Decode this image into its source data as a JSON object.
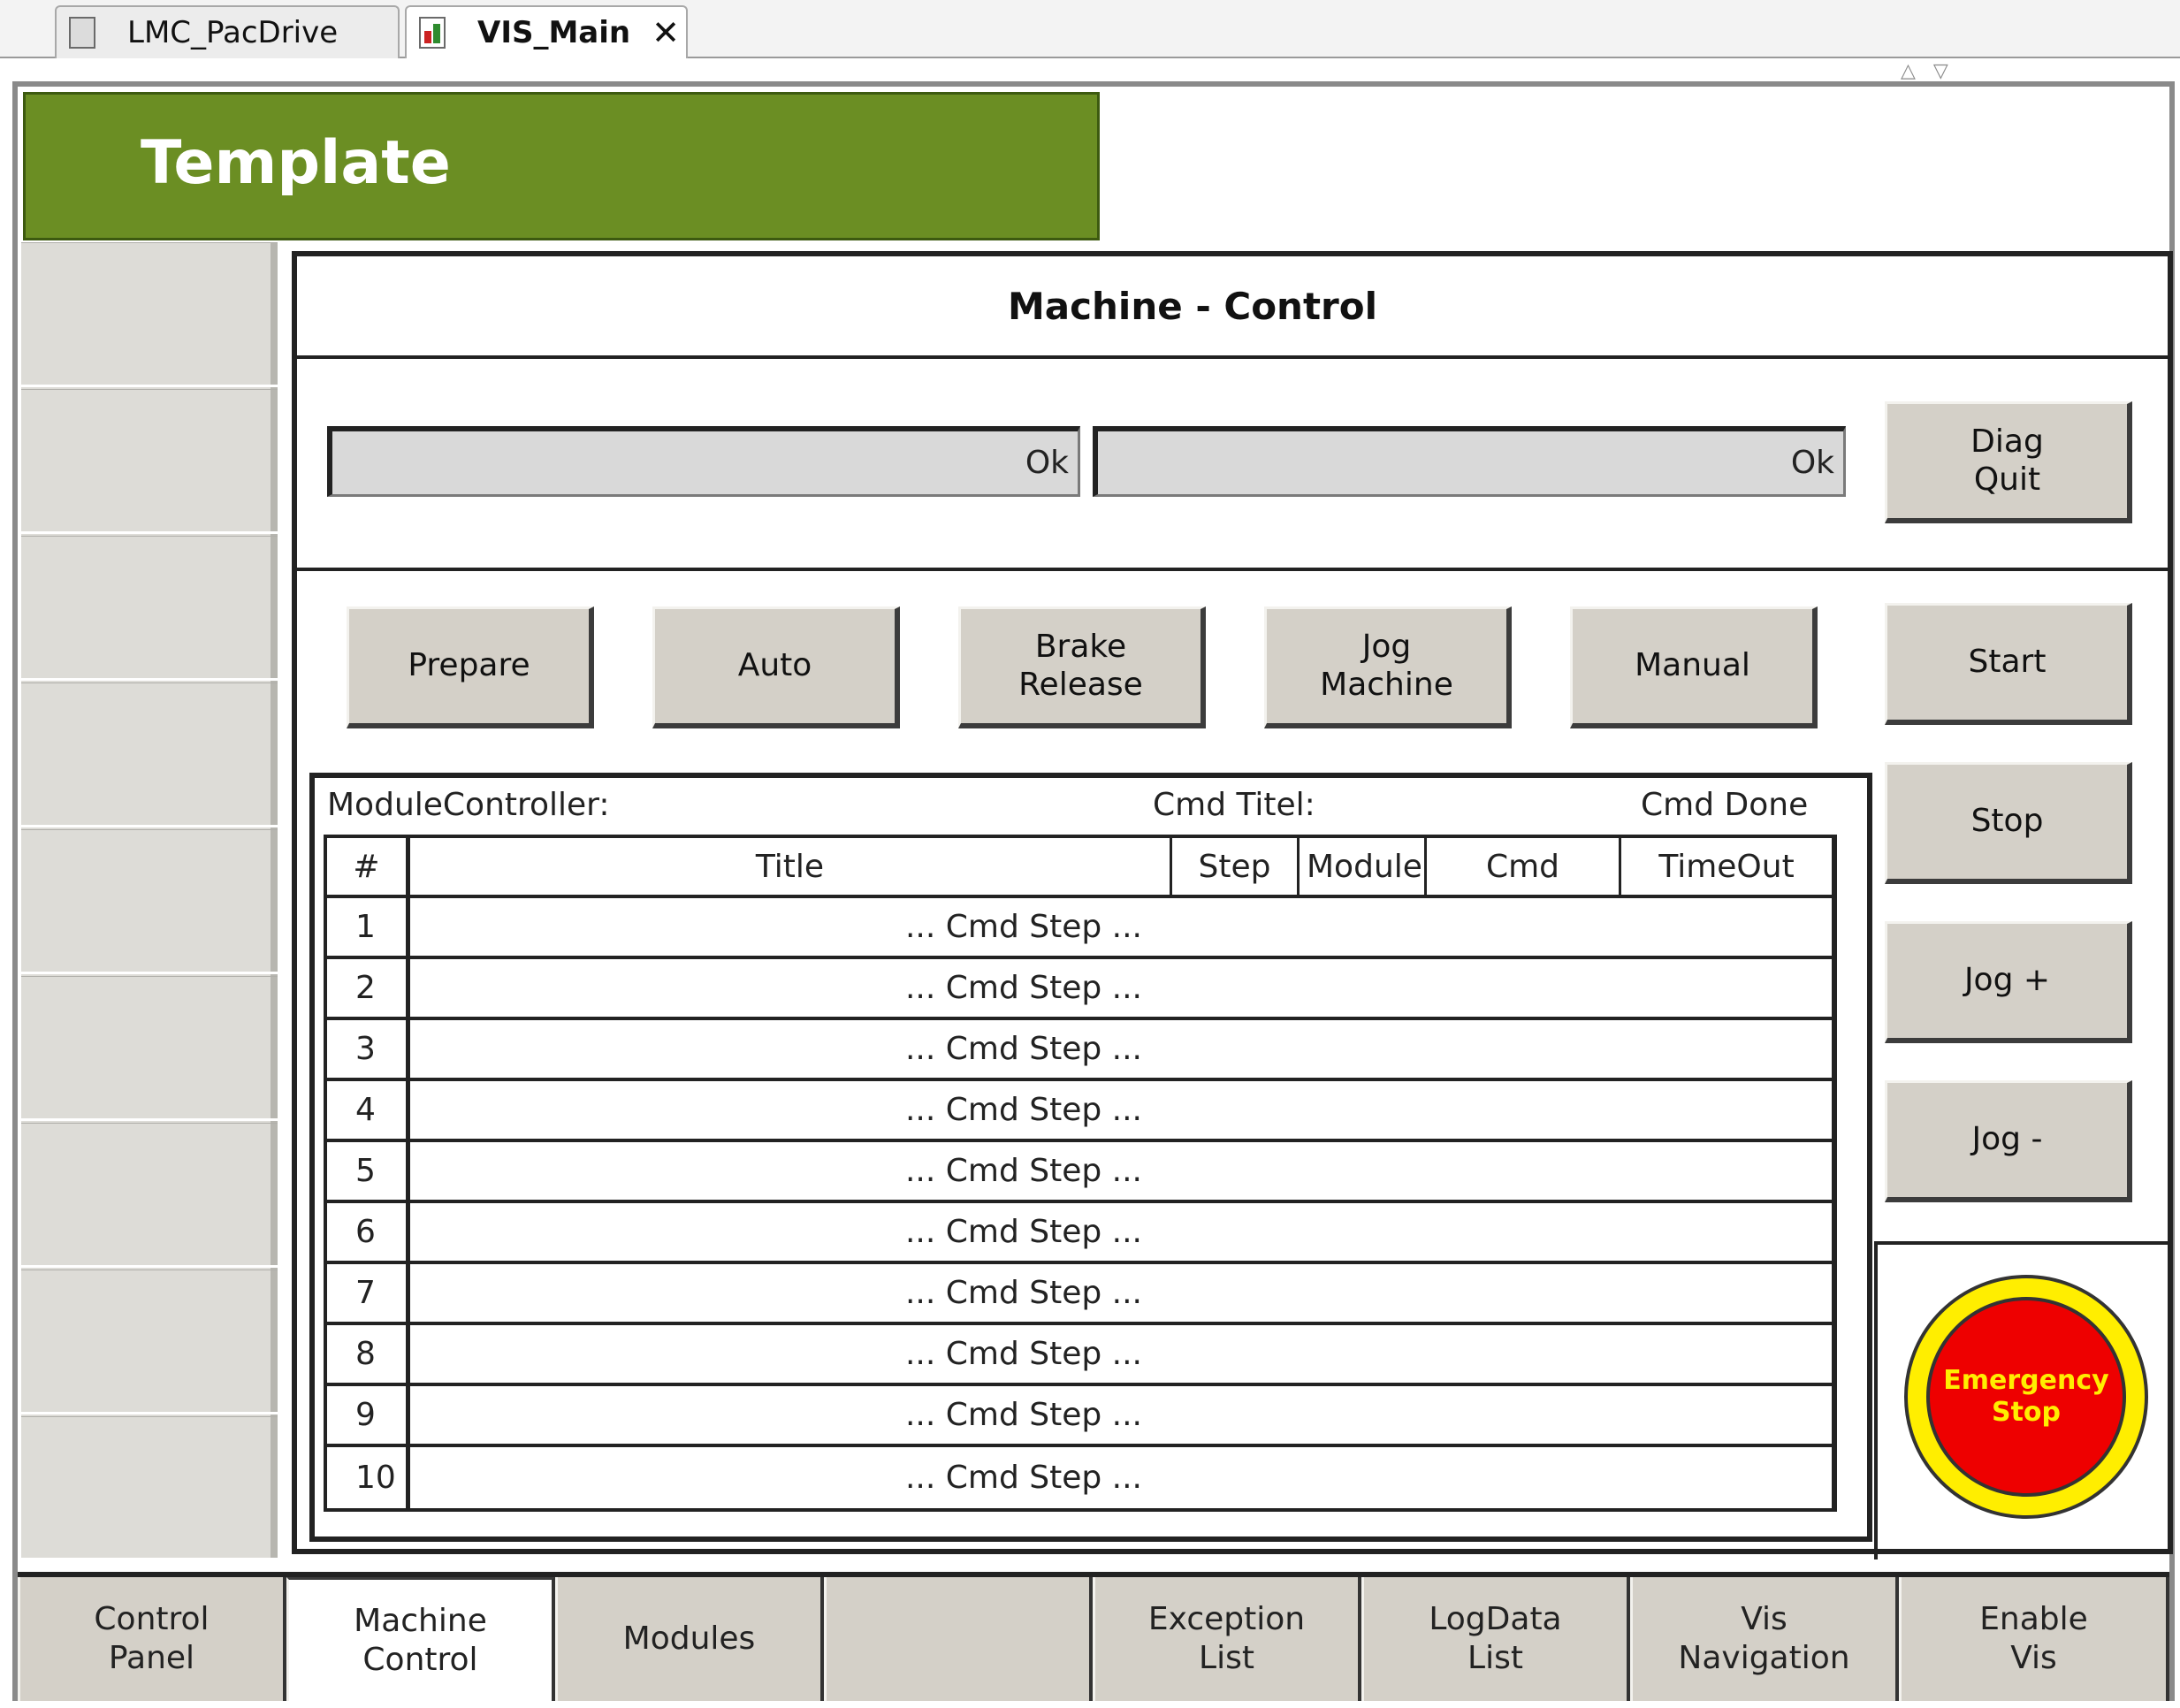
{
  "tabs": [
    {
      "label": "LMC_PacDrive",
      "icon": "project-icon",
      "active": false
    },
    {
      "label": "VIS_Main",
      "icon": "visualization-icon",
      "active": true
    }
  ],
  "header": {
    "title": "Template",
    "color": "#6b8e23"
  },
  "main": {
    "title": "Machine - Control",
    "status": {
      "field1": "Ok",
      "field2": "Ok",
      "diag_button": "Diag\nQuit"
    },
    "mode_buttons": [
      "Prepare",
      "Auto",
      "Brake\nRelease",
      "Jog\nMachine",
      "Manual"
    ],
    "right_buttons": [
      "Start",
      "Stop",
      "Jog +",
      "Jog -"
    ],
    "module_controller": {
      "label": "ModuleController:",
      "cmd_title_label": "Cmd Titel:",
      "cmd_done_label": "Cmd Done",
      "columns": [
        "#",
        "Title",
        "Step",
        "Module",
        "Cmd",
        "TimeOut"
      ],
      "rows": [
        {
          "num": "1",
          "text": "... Cmd Step ..."
        },
        {
          "num": "2",
          "text": "... Cmd Step ..."
        },
        {
          "num": "3",
          "text": "... Cmd Step ..."
        },
        {
          "num": "4",
          "text": "... Cmd Step ..."
        },
        {
          "num": "5",
          "text": "... Cmd Step ..."
        },
        {
          "num": "6",
          "text": "... Cmd Step ..."
        },
        {
          "num": "7",
          "text": "... Cmd Step ..."
        },
        {
          "num": "8",
          "text": "... Cmd Step ..."
        },
        {
          "num": "9",
          "text": "... Cmd Step ..."
        },
        {
          "num": "10",
          "text": "... Cmd Step ..."
        }
      ]
    },
    "emergency_stop": {
      "label": "Emergency\nStop",
      "color": "#ee0000",
      "ring_color": "#ffee00"
    }
  },
  "bottom_nav": [
    {
      "label": "Control\nPanel",
      "selected": false
    },
    {
      "label": "Machine\nControl",
      "selected": true
    },
    {
      "label": "Modules",
      "selected": false
    },
    {
      "label": "",
      "selected": false
    },
    {
      "label": "Exception\nList",
      "selected": false
    },
    {
      "label": "LogData\nList",
      "selected": false
    },
    {
      "label": "Vis\nNavigation",
      "selected": false
    },
    {
      "label": "Enable\nVis",
      "selected": false
    }
  ]
}
